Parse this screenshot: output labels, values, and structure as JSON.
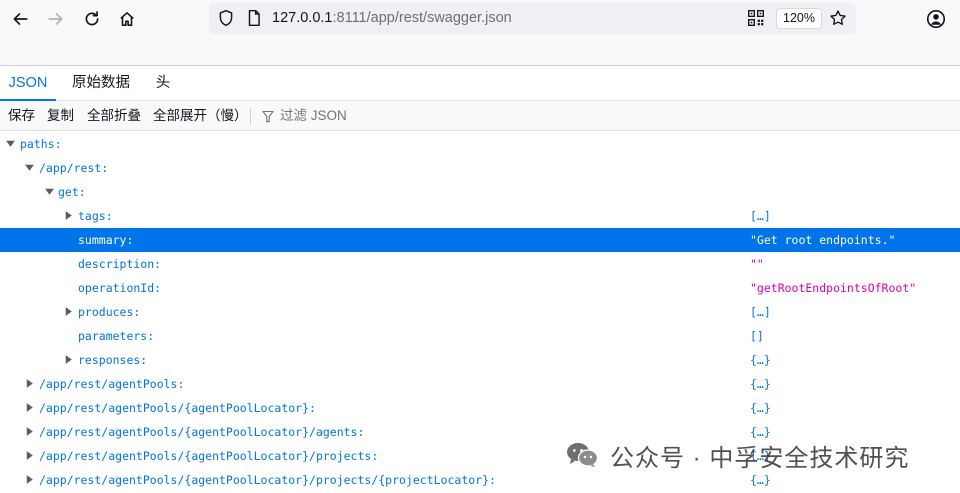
{
  "url": {
    "host": "127.0.0.1",
    "rest": ":8111/app/rest/swagger.json",
    "zoom": "120%"
  },
  "icons": {
    "back": "arrow-left-icon",
    "forward": "arrow-right-icon",
    "reload": "reload-icon",
    "home": "home-icon",
    "shield": "shield-icon",
    "page": "page-icon",
    "qr": "qr-code-icon",
    "star": "star-icon",
    "account": "account-icon",
    "filter": "filter-icon",
    "wechat": "wechat-icon"
  },
  "tabs": [
    "JSON",
    "原始数据",
    "头"
  ],
  "actions": {
    "save": "保存",
    "copy": "复制",
    "collapse_all": "全部折叠",
    "expand_all": "全部展开（慢）",
    "filter": "过滤 JSON"
  },
  "tree": [
    {
      "key": "paths:",
      "value": "",
      "type": "none",
      "toggle": "open",
      "depth": 0,
      "selected": false
    },
    {
      "key": "/app/rest:",
      "value": "",
      "type": "none",
      "toggle": "open",
      "depth": 1,
      "selected": false
    },
    {
      "key": "get:",
      "value": "",
      "type": "none",
      "toggle": "open",
      "depth": 2,
      "selected": false
    },
    {
      "key": "tags:",
      "value": "[…]",
      "type": "collapsed",
      "toggle": "closed",
      "depth": 3,
      "selected": false
    },
    {
      "key": "summary:",
      "value": "\"Get root endpoints.\"",
      "type": "str",
      "toggle": "none",
      "depth": 3,
      "selected": true
    },
    {
      "key": "description:",
      "value": "\"\"",
      "type": "str",
      "toggle": "none",
      "depth": 3,
      "selected": false
    },
    {
      "key": "operationId:",
      "value": "\"getRootEndpointsOfRoot\"",
      "type": "str",
      "toggle": "none",
      "depth": 3,
      "selected": false
    },
    {
      "key": "produces:",
      "value": "[…]",
      "type": "collapsed",
      "toggle": "closed",
      "depth": 3,
      "selected": false
    },
    {
      "key": "parameters:",
      "value": "[]",
      "type": "collapsed",
      "toggle": "none",
      "depth": 3,
      "selected": false
    },
    {
      "key": "responses:",
      "value": "{…}",
      "type": "collapsed",
      "toggle": "closed",
      "depth": 3,
      "selected": false
    },
    {
      "key": "/app/rest/agentPools:",
      "value": "{…}",
      "type": "collapsed",
      "toggle": "closed",
      "depth": 1,
      "selected": false
    },
    {
      "key": "/app/rest/agentPools/{agentPoolLocator}:",
      "value": "{…}",
      "type": "collapsed",
      "toggle": "closed",
      "depth": 1,
      "selected": false
    },
    {
      "key": "/app/rest/agentPools/{agentPoolLocator}/agents:",
      "value": "{…}",
      "type": "collapsed",
      "toggle": "closed",
      "depth": 1,
      "selected": false
    },
    {
      "key": "/app/rest/agentPools/{agentPoolLocator}/projects:",
      "value": "{…}",
      "type": "collapsed",
      "toggle": "closed",
      "depth": 1,
      "selected": false
    },
    {
      "key": "/app/rest/agentPools/{agentPoolLocator}/projects/{projectLocator}:",
      "value": "{…}",
      "type": "collapsed",
      "toggle": "closed",
      "depth": 1,
      "selected": false
    }
  ],
  "watermark": "公众号 · 中孚安全技术研究",
  "colors": {
    "accent": "#0074e8",
    "string": "#dd00a9"
  }
}
